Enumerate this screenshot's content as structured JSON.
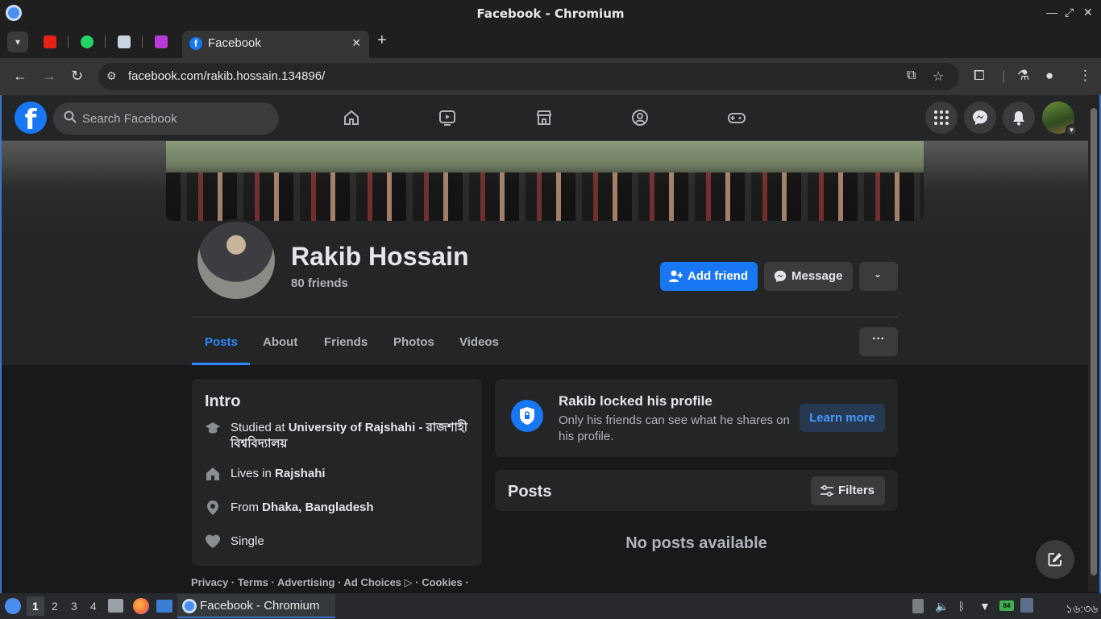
{
  "window": {
    "title": "Facebook - Chromium"
  },
  "tabs": {
    "active_label": "Facebook",
    "pinned": [
      {
        "name": "youtube",
        "color": "#e62117"
      },
      {
        "name": "whatsapp",
        "color": "#25d366"
      },
      {
        "name": "tumblr",
        "color": "#c9d4e0"
      },
      {
        "name": "app",
        "color": "#b83ad8"
      }
    ]
  },
  "toolbar": {
    "url": "facebook.com/rakib.hossain.134896/"
  },
  "fb": {
    "logo": "f",
    "search_placeholder": "Search Facebook"
  },
  "profile": {
    "name": "Rakib Hossain",
    "friends": "80 friends",
    "add_friend": "Add friend",
    "message": "Message",
    "tabs": [
      "Posts",
      "About",
      "Friends",
      "Photos",
      "Videos"
    ],
    "more": "···"
  },
  "intro": {
    "title": "Intro",
    "studied_prefix": "Studied at ",
    "studied_value": "University of Rajshahi - রাজশাহী বিশ্ববিদ্যালয়",
    "lives_prefix": "Lives in ",
    "lives_value": "Rajshahi",
    "from_prefix": "From ",
    "from_value": "Dhaka, Bangladesh",
    "relationship": "Single"
  },
  "locked": {
    "title": "Rakib locked his profile",
    "desc": "Only his friends can see what he shares on his profile.",
    "learn_more": "Learn more"
  },
  "posts": {
    "title": "Posts",
    "filters": "Filters",
    "empty": "No posts available"
  },
  "footer": {
    "links": "Privacy · Terms · Advertising · Ad Choices ▷ · Cookies ·"
  },
  "taskbar": {
    "workspaces": [
      "1",
      "2",
      "3",
      "4"
    ],
    "task_label": "Facebook - Chromium",
    "clock": "১৬:৩৬",
    "battery": "84"
  },
  "colors": {
    "fb_blue": "#1877f2",
    "fb_bg": "#18191a",
    "card": "#242526"
  }
}
